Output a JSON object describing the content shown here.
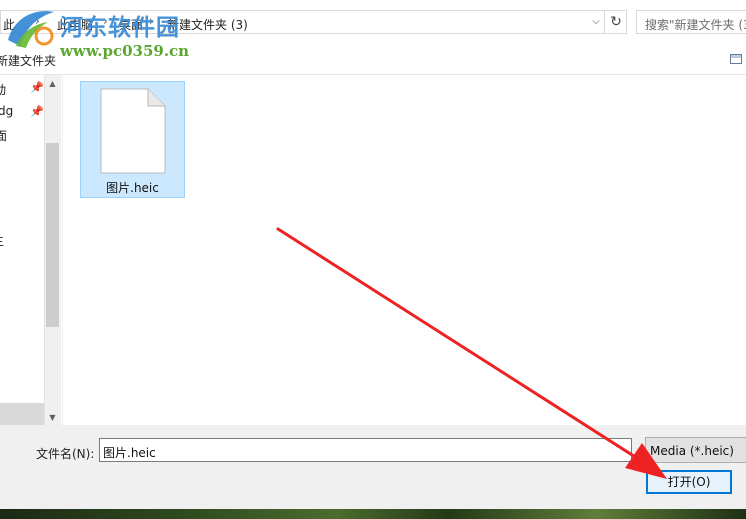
{
  "address": {
    "crumb_partial": "此",
    "crumbs": [
      "此电脑",
      "桌面",
      "新建文件夹 (3)"
    ],
    "separator": "›",
    "dropdown_icon": "chevron-down-icon",
    "refresh_icon": "refresh-icon"
  },
  "search": {
    "placeholder": "搜索\"新建文件夹 (3"
  },
  "toolbar": {
    "new_folder_label": "新建文件夹"
  },
  "nav": {
    "items": [
      {
        "label": "动"
      },
      {
        "label": "dg"
      },
      {
        "label": "面"
      },
      {
        "label": "主"
      }
    ]
  },
  "files": [
    {
      "name": "图片.heic",
      "selected": true
    }
  ],
  "bottom": {
    "filename_label": "文件名(N):",
    "filename_value": "图片.heic",
    "filetype_value": "Media (*.heic)",
    "open_label": "打开(O)"
  },
  "watermark": {
    "title": "河东软件园",
    "url": "www.pc0359.cn"
  },
  "colors": {
    "selection_fill": "#cce8ff",
    "selection_border": "#99d1ff",
    "primary_button_border": "#0078d7",
    "arrow": "#ee2222"
  }
}
